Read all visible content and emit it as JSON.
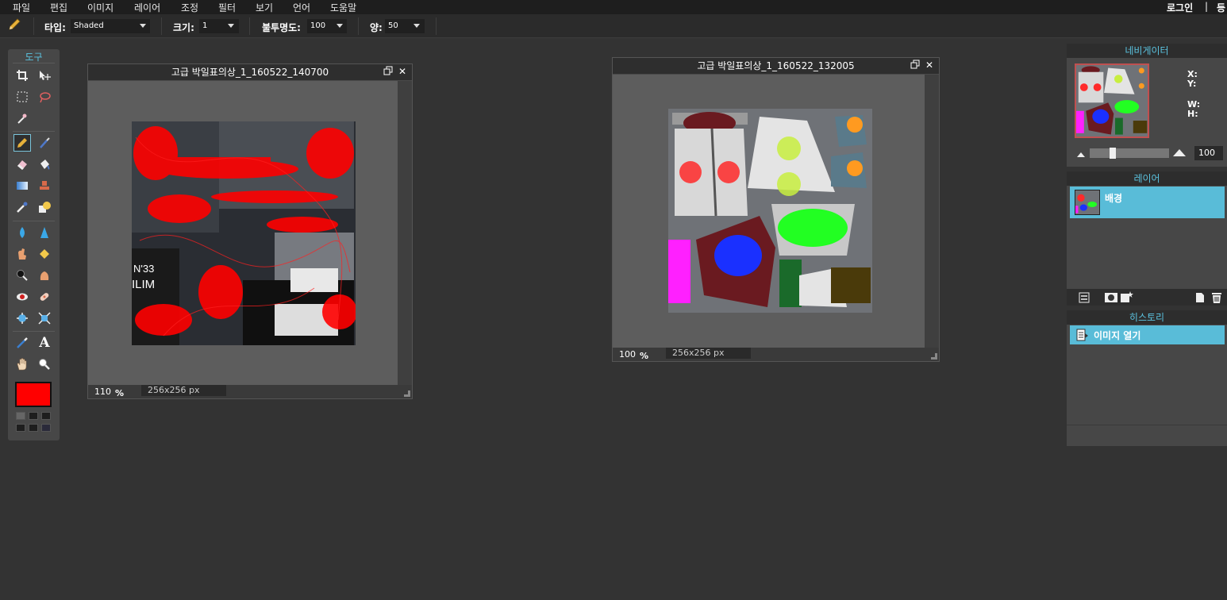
{
  "menu": {
    "items": [
      "파일",
      "편집",
      "이미지",
      "레이어",
      "조정",
      "필터",
      "보기",
      "언어",
      "도움말"
    ],
    "login": "로그인",
    "separator": "|",
    "signup": "등"
  },
  "options": {
    "tool_icon": "pencil-icon",
    "type_label": "타입:",
    "type_value": "Shaded",
    "size_label": "크기:",
    "size_value": "1",
    "opacity_label": "불투명도:",
    "opacity_value": "100",
    "amount_label": "양:",
    "amount_value": "50"
  },
  "toolbox": {
    "title": "도구",
    "foreground_color": "#ff0000",
    "tools": [
      "crop-icon",
      "move-icon",
      "marquee-icon",
      "lasso-icon",
      "magic-wand-icon",
      "pencil-icon",
      "brush-icon",
      "eraser-icon",
      "paint-bucket-icon",
      "gradient-icon",
      "clone-stamp-icon",
      "color-replace-icon",
      "shape-icon",
      "blur-icon",
      "sharpen-icon",
      "smudge-icon",
      "sponge-icon",
      "dodge-icon",
      "burn-icon",
      "red-eye-icon",
      "spot-heal-icon",
      "bloat-icon",
      "pinch-icon",
      "color-picker-icon",
      "type-icon",
      "hand-icon",
      "zoom-icon"
    ]
  },
  "documents": [
    {
      "title": "고급 박일표의상_1_160522_140700",
      "zoom": "110",
      "pct": "%",
      "dims": "256x256 px"
    },
    {
      "title": "고급 박일표의상_1_160522_132005",
      "zoom": "100",
      "pct": "%",
      "dims": "256x256 px"
    }
  ],
  "navigator": {
    "title": "네비게이터",
    "x_label": "X:",
    "y_label": "Y:",
    "w_label": "W:",
    "h_label": "H:",
    "zoom_value": "100"
  },
  "layers": {
    "title": "레이어",
    "items": [
      {
        "name": "배경"
      }
    ]
  },
  "history": {
    "title": "히스토리",
    "items": [
      {
        "name": "이미지 열기"
      }
    ]
  },
  "accent_color": "#5bc3e0",
  "selected_row_color": "#59bcd8"
}
